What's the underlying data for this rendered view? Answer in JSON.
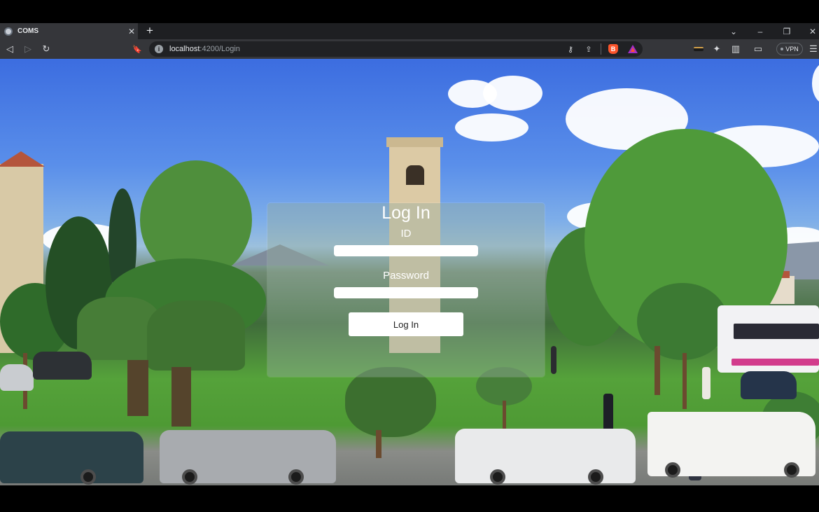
{
  "browser": {
    "tab": {
      "title": "COMS",
      "close_glyph": "✕"
    },
    "new_tab_glyph": "+",
    "window_controls": {
      "tab_search_glyph": "⌄",
      "minimize_glyph": "–",
      "restore_glyph": "❐",
      "close_glyph": "✕"
    },
    "nav": {
      "back_glyph": "◁",
      "forward_glyph": "▷",
      "reload_glyph": "↻",
      "bookmark_glyph": "🔖"
    },
    "address": {
      "host": "localhost",
      "path": ":4200/Login"
    },
    "address_icons": {
      "key_glyph": "⚷",
      "share_glyph": "⇪"
    },
    "toolbar_icons": {
      "extensions_glyph": "✦",
      "sidebar_glyph": "▥",
      "wallet_glyph": "▭",
      "menu_glyph": "☰"
    },
    "vpn": {
      "label": "VPN"
    },
    "colors": {
      "tabstrip": "#1e1f22",
      "toolbar": "#35363a",
      "omnibox": "#202124"
    }
  },
  "login": {
    "title": "Log In",
    "id_label": "ID",
    "id_value": "",
    "password_label": "Password",
    "password_value": "",
    "submit_label": "Log In"
  }
}
